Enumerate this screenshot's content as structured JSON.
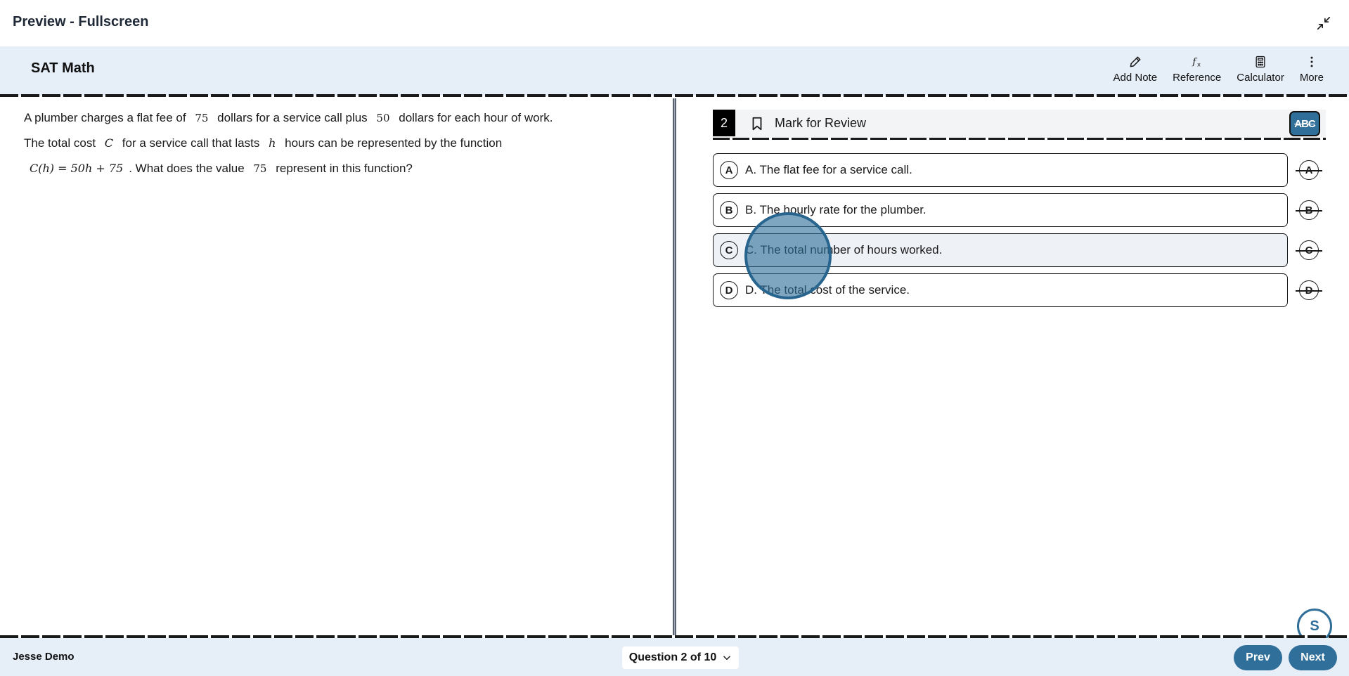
{
  "preview": {
    "title": "Preview - Fullscreen"
  },
  "header": {
    "title": "SAT Math",
    "tools": [
      {
        "label": "Add Note",
        "icon": "pencil-icon"
      },
      {
        "label": "Reference",
        "icon": "function-icon"
      },
      {
        "label": "Calculator",
        "icon": "calculator-icon"
      },
      {
        "label": "More",
        "icon": "more-vertical-icon"
      }
    ]
  },
  "question": {
    "number": "2",
    "mark_label": "Mark for Review",
    "abc_label": "ABC",
    "stem": {
      "p1": "A plumber charges a flat fee of",
      "m1": "75",
      "p2": "dollars for a service call plus",
      "m2": "50",
      "p3": "dollars for each hour of work.",
      "p4": "The total cost",
      "m3": "C",
      "p5": "for a service call that lasts",
      "m4": "h",
      "p6": "hours can be represented by the function",
      "m5": "C(h) = 50h + 75",
      "p7": ". What does the value",
      "m6": "75",
      "p8": "represent in this function?"
    },
    "options": [
      {
        "letter": "A",
        "text": "A. The flat fee for a service call."
      },
      {
        "letter": "B",
        "text": "B. The hourly rate for the plumber."
      },
      {
        "letter": "C",
        "text": "C. The total number of hours worked."
      },
      {
        "letter": "D",
        "text": "D. The total cost of the service."
      }
    ]
  },
  "footer": {
    "user": "Jesse Demo",
    "question_nav": "Question 2 of 10",
    "prev": "Prev",
    "next": "Next",
    "help_letter": "S"
  },
  "colors": {
    "accent": "#2f6f99",
    "header_bg": "#e6eef8"
  }
}
